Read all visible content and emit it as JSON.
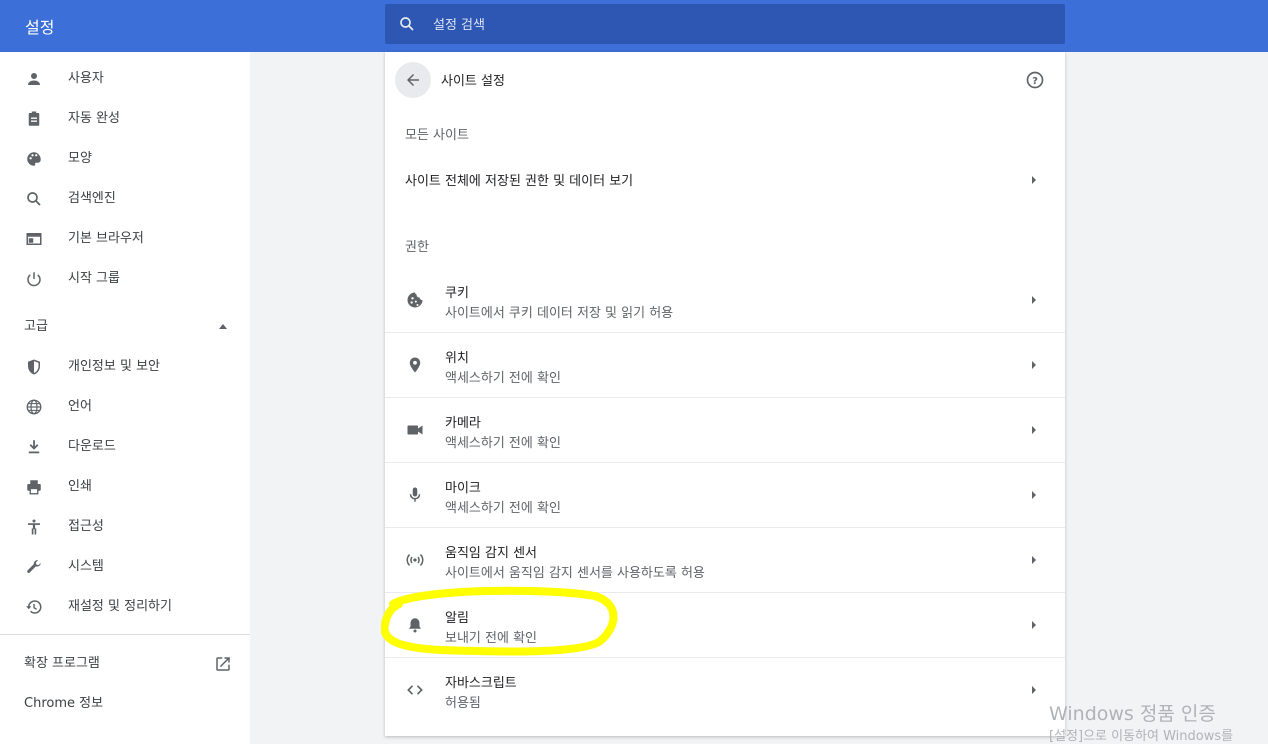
{
  "app": {
    "title": "설정"
  },
  "search": {
    "placeholder": "설정 검색"
  },
  "sidebar": {
    "items": [
      {
        "label": "사용자",
        "icon": "person-icon"
      },
      {
        "label": "자동 완성",
        "icon": "clipboard-icon"
      },
      {
        "label": "모양",
        "icon": "palette-icon"
      },
      {
        "label": "검색엔진",
        "icon": "search-icon"
      },
      {
        "label": "기본 브라우저",
        "icon": "browser-window-icon"
      },
      {
        "label": "시작 그룹",
        "icon": "power-icon"
      }
    ],
    "advanced_label": "고급",
    "advanced_items": [
      {
        "label": "개인정보 및 보안",
        "icon": "shield-icon"
      },
      {
        "label": "언어",
        "icon": "globe-icon"
      },
      {
        "label": "다운로드",
        "icon": "download-icon"
      },
      {
        "label": "인쇄",
        "icon": "printer-icon"
      },
      {
        "label": "접근성",
        "icon": "accessibility-icon"
      },
      {
        "label": "시스템",
        "icon": "wrench-icon"
      },
      {
        "label": "재설정 및 정리하기",
        "icon": "restore-icon"
      }
    ],
    "extensions_label": "확장 프로그램",
    "about_label": "Chrome 정보"
  },
  "main": {
    "title": "사이트 설정",
    "all_sites_header": "모든 사이트",
    "all_sites_row": "사이트 전체에 저장된 권한 및 데이터 보기",
    "permissions_header": "권한",
    "permissions": [
      {
        "title": "쿠키",
        "subtitle": "사이트에서 쿠키 데이터 저장 및 읽기 허용",
        "icon": "cookie-icon"
      },
      {
        "title": "위치",
        "subtitle": "액세스하기 전에 확인",
        "icon": "location-pin-icon"
      },
      {
        "title": "카메라",
        "subtitle": "액세스하기 전에 확인",
        "icon": "camera-icon"
      },
      {
        "title": "마이크",
        "subtitle": "액세스하기 전에 확인",
        "icon": "microphone-icon"
      },
      {
        "title": "움직임 감지 센서",
        "subtitle": "사이트에서 움직임 감지 센서를 사용하도록 허용",
        "icon": "sensors-icon"
      },
      {
        "title": "알림",
        "subtitle": "보내기 전에 확인",
        "icon": "bell-icon"
      },
      {
        "title": "자바스크립트",
        "subtitle": "허용됨",
        "icon": "code-icon"
      }
    ]
  },
  "watermark": {
    "line1": "Windows 정품 인증",
    "line2": "[설정]으로 이동하여 Windows를"
  },
  "colors": {
    "header_bg": "#3c6fd8",
    "search_bg": "#2e57b3",
    "highlight": "#ffff00"
  }
}
